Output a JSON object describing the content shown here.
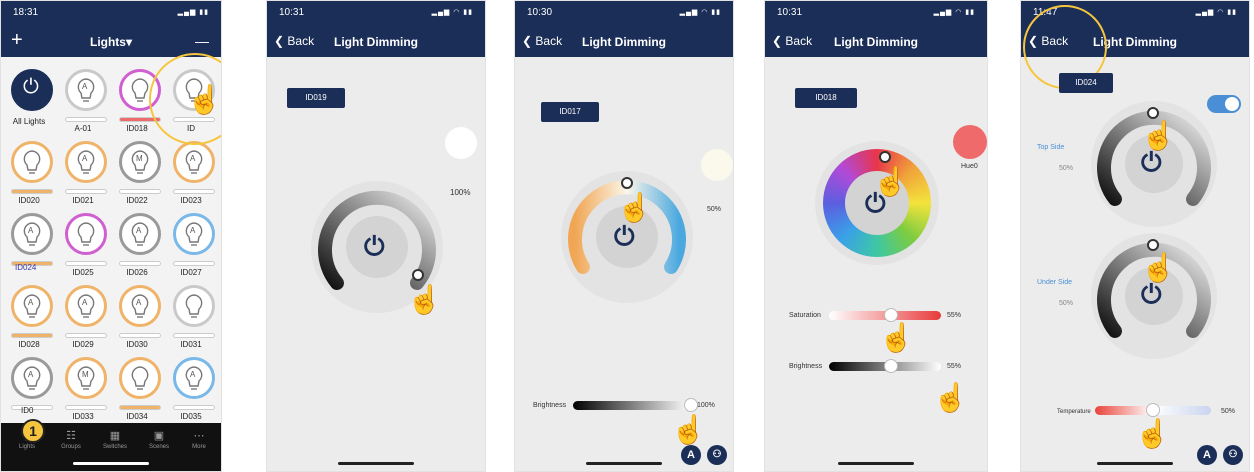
{
  "colors": {
    "navbar": "#1b2e57",
    "accent_blue": "#4a8fd6",
    "highlight": "#f6c53e",
    "hue_red": "#ef6b6b"
  },
  "screen1": {
    "time": "18:31",
    "title": "Lights▾",
    "add_icon": "+",
    "minus_icon": "—",
    "lights": [
      {
        "label": "All Lights",
        "kind": "power"
      },
      {
        "label": "A-01",
        "mark": "A",
        "ring": "#c9c9c9",
        "bar": "#ffffff"
      },
      {
        "label": "ID018",
        "mark": "",
        "ring": "rainbow",
        "bar": "#ef6b6b"
      },
      {
        "label": "ID",
        "mark": "",
        "ring": "#c9c9c9",
        "bar": "#ffffff"
      },
      {
        "label": "ID020",
        "mark": "",
        "ring": "#f0b36a",
        "bar": "#f0b36a"
      },
      {
        "label": "ID021",
        "mark": "A",
        "ring": "#f0b36a",
        "bar": "#ffffff"
      },
      {
        "label": "ID022",
        "mark": "M",
        "ring": "#9a9a9a",
        "bar": "#ffffff"
      },
      {
        "label": "ID023",
        "mark": "A",
        "ring": "#f0b36a",
        "bar": "#ffffff"
      },
      {
        "label": "",
        "mark": "A",
        "ring": "#9a9a9a",
        "bar": "#f0b36a"
      },
      {
        "label": "ID025",
        "mark": "",
        "ring": "rainbow",
        "bar": "#ffffff"
      },
      {
        "label": "ID026",
        "mark": "A",
        "ring": "#9a9a9a",
        "bar": "#ffffff"
      },
      {
        "label": "ID027",
        "mark": "A",
        "ring": "#7ab8e8",
        "bar": "#ffffff"
      },
      {
        "label": "ID028",
        "mark": "A",
        "ring": "#f0b36a",
        "bar": "#f0b36a"
      },
      {
        "label": "ID029",
        "mark": "A",
        "ring": "#f0b36a",
        "bar": "#ffffff"
      },
      {
        "label": "ID030",
        "mark": "A",
        "ring": "#f0b36a",
        "bar": "#ffffff"
      },
      {
        "label": "ID031",
        "mark": "",
        "ring": "#c9c9c9",
        "bar": "#ffffff"
      },
      {
        "label": "",
        "mark": "A",
        "ring": "#9a9a9a",
        "bar": "#ffffff"
      },
      {
        "label": "ID033",
        "mark": "M",
        "ring": "#f0b36a",
        "bar": "#ffffff"
      },
      {
        "label": "ID034",
        "mark": "",
        "ring": "#f0b36a",
        "bar": "#f0b36a"
      },
      {
        "label": "ID035",
        "mark": "A",
        "ring": "#7ab8e8",
        "bar": "#ffffff"
      }
    ],
    "selected_label": "ID024",
    "partial_label": "ID0",
    "step": "1",
    "tabs": [
      "Lights",
      "Groups",
      "Switches",
      "Scenes",
      "More"
    ]
  },
  "screen2": {
    "time": "10:31",
    "back": "Back",
    "title": "Light Dimming",
    "id": "ID019",
    "percent": "100%",
    "brightness": 1.0
  },
  "screen3": {
    "time": "10:30",
    "back": "Back",
    "title": "Light Dimming",
    "id": "ID017",
    "percent": "50%",
    "brightness_label": "Brightness",
    "brightness_value": "100%",
    "brightness": 1.0,
    "auto_icon": "A",
    "motion_icon": "sensor-icon"
  },
  "screen4": {
    "time": "10:31",
    "back": "Back",
    "title": "Light Dimming",
    "id": "ID018",
    "hue_label": "Hue0",
    "saturation_label": "Saturation",
    "saturation_value": "55%",
    "saturation": 0.55,
    "brightness_label": "Brightness",
    "brightness_value": "55%",
    "brightness": 0.55
  },
  "screen5": {
    "time": "11:47",
    "back": "Back",
    "title": "Light Dimming",
    "id": "ID024",
    "top_label": "Top Side",
    "top_value": "50%",
    "under_label": "Under Side",
    "under_value": "50%",
    "temperature_label": "Temperature",
    "temperature_value": "50%",
    "temperature": 0.5,
    "auto_icon": "A"
  }
}
